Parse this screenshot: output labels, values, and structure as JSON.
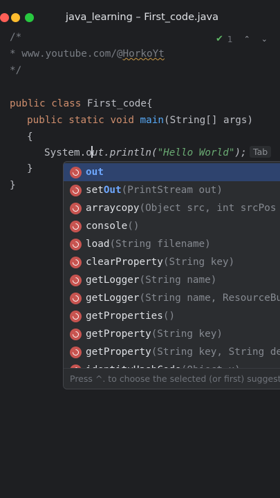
{
  "window": {
    "title": "java_learning – First_code.java"
  },
  "inspections": {
    "count": "1"
  },
  "code": {
    "line1": "/*",
    "line2_prefix": "* www.youtube.com/@",
    "line2_handle": "HorkoYt",
    "line3": "*/",
    "line5_public": "public",
    "line5_class": "class",
    "line5_name": "First_code{",
    "line6_mods": "public static void",
    "line6_method": "main",
    "line6_params": "(String[] args)",
    "line7": "{",
    "line8_obj": "System.o",
    "line8_rest": "ut.println(",
    "line8_string": "\"Hello World\"",
    "line8_end": ");",
    "line9": "}",
    "line10": "}"
  },
  "completion": {
    "tab_hint": "Tab",
    "items": [
      {
        "match": "out",
        "name_rest": "",
        "signature": ""
      },
      {
        "match": "set",
        "name_rest": "Out",
        "signature": "(PrintStream out)"
      },
      {
        "match": "arraycopy",
        "name_rest": "",
        "signature": "(Object src, int srcPos"
      },
      {
        "match": "console",
        "name_rest": "",
        "signature": "()"
      },
      {
        "match": "load",
        "name_rest": "",
        "signature": "(String filename)"
      },
      {
        "match": "clearProperty",
        "name_rest": "",
        "signature": "(String key)"
      },
      {
        "match": "getLogger",
        "name_rest": "",
        "signature": "(String name)"
      },
      {
        "match": "getLogger",
        "name_rest": "",
        "signature": "(String name, ResourceBu"
      },
      {
        "match": "getProperties",
        "name_rest": "",
        "signature": "()"
      },
      {
        "match": "getProperty",
        "name_rest": "",
        "signature": "(String key)"
      },
      {
        "match": "getProperty",
        "name_rest": "",
        "signature": "(String key, String de"
      },
      {
        "match": "identityHashCode",
        "name_rest": "",
        "signature": "(Object x)"
      }
    ],
    "footer": "Press ^. to choose the selected (or first) suggestion"
  }
}
